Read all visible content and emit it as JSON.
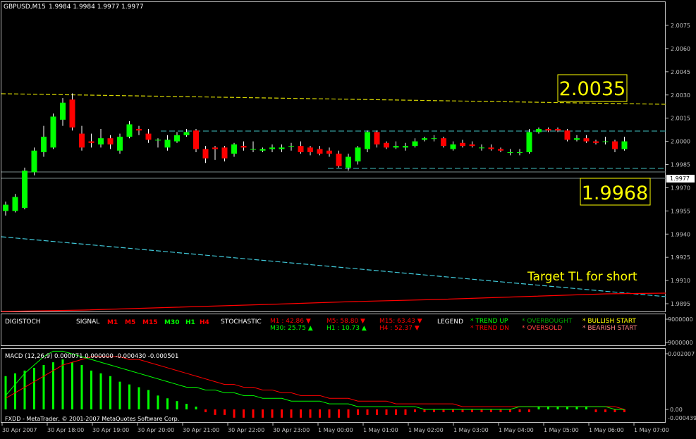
{
  "symbol_header": "GBPUSD,M15",
  "ohlc_header": "1.9984 1.9984 1.9977 1.9977",
  "colors": {
    "bull": "#00ff00",
    "bear": "#ff0000",
    "wick": "#ffffff",
    "grid": "#2a3a3a",
    "axis": "#c0c0c0",
    "upper_tl": "#d6d600",
    "box_text": "#ffff00",
    "range_line": "#40c0c0",
    "target_tl": "#40c8d8",
    "red_ma": "#ff0000",
    "macd_signal": "#ff0000",
    "macd_main": "#00ff00",
    "macd_hist": "#ff0000"
  },
  "main_chart": {
    "price_axis": [
      "2.0075",
      "2.0060",
      "2.0045",
      "2.0030",
      "2.0015",
      "2.0000",
      "1.9985",
      "1.9970",
      "1.9955",
      "1.9940",
      "1.9925",
      "1.9910",
      "1.9895"
    ],
    "current_price_tag": "1.9977",
    "label_upper": "2.0035",
    "label_lower": "1.9968",
    "annotation": "Target TL for short",
    "candles": [
      {
        "o": 1.9955,
        "h": 1.9961,
        "l": 1.9952,
        "c": 1.9959
      },
      {
        "o": 1.9955,
        "h": 1.9966,
        "l": 1.9954,
        "c": 1.9964
      },
      {
        "o": 1.9957,
        "h": 1.9983,
        "l": 1.9956,
        "c": 1.9981
      },
      {
        "o": 1.998,
        "h": 1.9996,
        "l": 1.9978,
        "c": 1.9994
      },
      {
        "o": 1.9993,
        "h": 2.001,
        "l": 1.999,
        "c": 2.0003
      },
      {
        "o": 1.9996,
        "h": 2.0018,
        "l": 1.9995,
        "c": 2.0016
      },
      {
        "o": 2.0014,
        "h": 2.0028,
        "l": 2.001,
        "c": 2.0025
      },
      {
        "o": 2.0027,
        "h": 2.0031,
        "l": 2.0007,
        "c": 2.0009
      },
      {
        "o": 2.0005,
        "h": 2.001,
        "l": 1.9994,
        "c": 1.9996
      },
      {
        "o": 2.0,
        "h": 2.0005,
        "l": 1.9996,
        "c": 1.9999
      },
      {
        "o": 1.9998,
        "h": 2.0008,
        "l": 1.9996,
        "c": 2.0002
      },
      {
        "o": 2.0002,
        "h": 2.0004,
        "l": 1.9995,
        "c": 1.9998
      },
      {
        "o": 1.9994,
        "h": 2.0005,
        "l": 1.9992,
        "c": 2.0003
      },
      {
        "o": 2.0003,
        "h": 2.0013,
        "l": 2.0002,
        "c": 2.0011
      },
      {
        "o": 2.0008,
        "h": 2.001,
        "l": 2.0004,
        "c": 2.0007
      },
      {
        "o": 2.0005,
        "h": 2.0008,
        "l": 1.9999,
        "c": 2.0001
      },
      {
        "o": 2.0001,
        "h": 2.0002,
        "l": 1.9996,
        "c": 2.0001
      },
      {
        "o": 1.9996,
        "h": 2.0004,
        "l": 1.9994,
        "c": 2.0001
      },
      {
        "o": 2.0,
        "h": 2.0006,
        "l": 1.9999,
        "c": 2.0004
      },
      {
        "o": 2.0004,
        "h": 2.0008,
        "l": 2.0003,
        "c": 2.0006
      },
      {
        "o": 2.0007,
        "h": 2.0008,
        "l": 1.9993,
        "c": 1.9995
      },
      {
        "o": 1.9995,
        "h": 1.9997,
        "l": 1.9986,
        "c": 1.9989
      },
      {
        "o": 1.9996,
        "h": 1.9997,
        "l": 1.9988,
        "c": 1.9995
      },
      {
        "o": 1.9996,
        "h": 1.9997,
        "l": 1.9987,
        "c": 1.9989
      },
      {
        "o": 1.9992,
        "h": 1.9999,
        "l": 1.999,
        "c": 1.9998
      },
      {
        "o": 1.9997,
        "h": 2.0,
        "l": 1.9994,
        "c": 1.9996
      },
      {
        "o": 1.9995,
        "h": 2.0,
        "l": 1.9993,
        "c": 1.9995
      },
      {
        "o": 1.9994,
        "h": 1.9996,
        "l": 1.9993,
        "c": 1.9995
      },
      {
        "o": 1.9995,
        "h": 1.9998,
        "l": 1.9993,
        "c": 1.9996
      },
      {
        "o": 1.9995,
        "h": 1.9998,
        "l": 1.9993,
        "c": 1.9996
      },
      {
        "o": 1.9997,
        "h": 1.9999,
        "l": 1.9994,
        "c": 1.9997
      },
      {
        "o": 1.9997,
        "h": 2.0,
        "l": 1.9992,
        "c": 1.9993
      },
      {
        "o": 1.9996,
        "h": 1.9997,
        "l": 1.9991,
        "c": 1.9993
      },
      {
        "o": 1.9995,
        "h": 1.9997,
        "l": 1.9991,
        "c": 1.9992
      },
      {
        "o": 1.9994,
        "h": 1.9996,
        "l": 1.999,
        "c": 1.9992
      },
      {
        "o": 1.9992,
        "h": 1.9994,
        "l": 1.9983,
        "c": 1.9984
      },
      {
        "o": 1.9983,
        "h": 1.9992,
        "l": 1.9981,
        "c": 1.999
      },
      {
        "o": 1.9987,
        "h": 1.9997,
        "l": 1.9985,
        "c": 1.9996
      },
      {
        "o": 1.9995,
        "h": 2.0007,
        "l": 1.9993,
        "c": 2.0006
      },
      {
        "o": 2.0006,
        "h": 2.0007,
        "l": 1.9996,
        "c": 1.9998
      },
      {
        "o": 1.9999,
        "h": 2.0,
        "l": 1.9995,
        "c": 1.9996
      },
      {
        "o": 1.9996,
        "h": 2.0,
        "l": 1.9995,
        "c": 1.9997
      },
      {
        "o": 1.9996,
        "h": 1.9999,
        "l": 1.9994,
        "c": 1.9997
      },
      {
        "o": 1.9997,
        "h": 2.0002,
        "l": 1.9996,
        "c": 2.0
      },
      {
        "o": 2.0001,
        "h": 2.0003,
        "l": 2.0,
        "c": 2.0002
      },
      {
        "o": 2.0002,
        "h": 2.0004,
        "l": 2.0,
        "c": 2.0002
      },
      {
        "o": 2.0002,
        "h": 2.0003,
        "l": 1.9996,
        "c": 1.9997
      },
      {
        "o": 1.9995,
        "h": 2.0,
        "l": 1.9994,
        "c": 1.9998
      },
      {
        "o": 1.9999,
        "h": 2.0001,
        "l": 1.9996,
        "c": 1.9997
      },
      {
        "o": 1.9998,
        "h": 2.0,
        "l": 1.9996,
        "c": 1.9997
      },
      {
        "o": 1.9996,
        "h": 1.9998,
        "l": 1.9994,
        "c": 1.9996
      },
      {
        "o": 1.9996,
        "h": 1.9998,
        "l": 1.9994,
        "c": 1.9995
      },
      {
        "o": 1.9995,
        "h": 1.9996,
        "l": 1.9993,
        "c": 1.9994
      },
      {
        "o": 1.9993,
        "h": 1.9995,
        "l": 1.9991,
        "c": 1.9993
      },
      {
        "o": 1.9993,
        "h": 1.9995,
        "l": 1.9991,
        "c": 1.9993
      },
      {
        "o": 1.9993,
        "h": 2.0008,
        "l": 1.9992,
        "c": 2.0006
      },
      {
        "o": 2.0006,
        "h": 2.0009,
        "l": 2.0005,
        "c": 2.0008
      },
      {
        "o": 2.0008,
        "h": 2.0009,
        "l": 2.0006,
        "c": 2.0007
      },
      {
        "o": 2.0008,
        "h": 2.0009,
        "l": 2.0006,
        "c": 2.0007
      },
      {
        "o": 2.0007,
        "h": 2.0008,
        "l": 2.0,
        "c": 2.0001
      },
      {
        "o": 2.0001,
        "h": 2.0004,
        "l": 2.0,
        "c": 2.0002
      },
      {
        "o": 2.0002,
        "h": 2.0004,
        "l": 1.9999,
        "c": 2.0
      },
      {
        "o": 2.0,
        "h": 2.0001,
        "l": 1.9998,
        "c": 1.9999
      },
      {
        "o": 2.0,
        "h": 2.0003,
        "l": 1.9998,
        "c": 2.0
      },
      {
        "o": 2.0,
        "h": 2.0001,
        "l": 1.9993,
        "c": 1.9995
      },
      {
        "o": 1.9995,
        "h": 2.0003,
        "l": 1.9994,
        "c": 2.0
      }
    ]
  },
  "digistoch": {
    "title": "DIGISTOCH",
    "signal_label": "SIGNAL",
    "tf_red": [
      "M1",
      "M5",
      "M15"
    ],
    "tf_green": [
      "M30",
      "H1"
    ],
    "tf_red2": [
      "H4"
    ],
    "stochastic_label": "STOCHASTIC",
    "stoch": {
      "m1": "M1   : 42.86 ▼",
      "m5": "M5: 58.80 ▼",
      "m15": "M15: 63.43 ▼",
      "m30": "M30: 25.75 ▲",
      "h1": "H1  : 10.73 ▲",
      "h4": "H4   : 52.37 ▼"
    },
    "legend_label": "LEGEND",
    "legend": {
      "trend_up": "* TREND UP",
      "trend_dn": "* TREND DN",
      "overbought": "* OVERBOUGHT",
      "oversold": "* OVERSOLD",
      "bullish": "* BULLISH START",
      "bearish": "* BEARISH START"
    },
    "axis_top": "9000000",
    "axis_bottom": "9000000"
  },
  "macd": {
    "header": "MACD  (12,26,9) 0.000071 0.000000 -0.000430 -0.000501",
    "axis_top": "0.002007",
    "axis_zero": "0.00",
    "axis_bottom": "-0.000439",
    "footer": "FXDD - MetaTrader, © 2001-2007 MetaQuotes Software Corp.",
    "hist": [
      0.0012,
      0.0013,
      0.0014,
      0.0015,
      0.0016,
      0.0017,
      0.0018,
      0.0017,
      0.0016,
      0.0014,
      0.0013,
      0.0012,
      0.001,
      0.0009,
      0.0008,
      0.0007,
      0.0005,
      0.0004,
      0.0003,
      0.0002,
      0.0001,
      -0.0001,
      -0.0002,
      -0.0002,
      -0.0003,
      -0.0003,
      -0.0003,
      -0.0003,
      -0.0003,
      -0.0003,
      -0.0003,
      -0.0003,
      -0.0003,
      -0.0003,
      -0.0003,
      -0.0003,
      -0.0003,
      -0.0002,
      -0.0002,
      -0.0002,
      -0.0002,
      -0.0002,
      -0.0002,
      -0.0001,
      -0.0001,
      -0.0001,
      -0.0001,
      -0.0001,
      -0.0001,
      -0.0001,
      -0.0001,
      -0.0001,
      -0.0001,
      -0.0001,
      -0.0001,
      -0.0001,
      0.0001,
      0.0001,
      0.0001,
      0.0001,
      0.0001,
      0.0001,
      -0.0001,
      -0.0001,
      -0.0001,
      -0.0001
    ],
    "signal": [
      0.0004,
      0.0006,
      0.0008,
      0.001,
      0.0012,
      0.0014,
      0.0016,
      0.0017,
      0.0018,
      0.0019,
      0.0019,
      0.0019,
      0.0019,
      0.0018,
      0.0018,
      0.0017,
      0.0016,
      0.0015,
      0.0014,
      0.0013,
      0.0012,
      0.0011,
      0.001,
      0.0009,
      0.0009,
      0.0008,
      0.0008,
      0.0007,
      0.0007,
      0.0006,
      0.0006,
      0.0005,
      0.0005,
      0.0005,
      0.0004,
      0.0004,
      0.0004,
      0.0003,
      0.0003,
      0.0003,
      0.0003,
      0.0002,
      0.0002,
      0.0002,
      0.0002,
      0.0002,
      0.0002,
      0.0002,
      0.0001,
      0.0001,
      0.0001,
      0.0001,
      0.0001,
      0.0001,
      0.0001,
      0.0001,
      0.0001,
      0.0001,
      0.0001,
      0.0001,
      0.0001,
      0.0001,
      0.0001,
      0.0001,
      0.0001,
      0.0
    ],
    "main": [
      0.0005,
      0.0009,
      0.0013,
      0.0016,
      0.0019,
      0.0021,
      0.0021,
      0.002,
      0.0019,
      0.0018,
      0.0017,
      0.0016,
      0.0015,
      0.0014,
      0.0013,
      0.0012,
      0.0011,
      0.001,
      0.0009,
      0.0008,
      0.0008,
      0.0007,
      0.0007,
      0.0006,
      0.0006,
      0.0005,
      0.0005,
      0.0004,
      0.0004,
      0.0004,
      0.0003,
      0.0003,
      0.0003,
      0.0003,
      0.0002,
      0.0002,
      0.0002,
      0.0001,
      0.0001,
      0.0001,
      0.0001,
      0.0001,
      0.0001,
      0.0001,
      0.0,
      0.0,
      0.0,
      0.0,
      0.0,
      0.0,
      0.0,
      0.0,
      0.0,
      0.0,
      0.0001,
      0.0001,
      0.0001,
      0.0001,
      0.0001,
      0.0001,
      0.0001,
      0.0001,
      0.0001,
      0.0001,
      0.0,
      0.0
    ]
  },
  "time_axis": [
    "30 Apr 2007",
    "30 Apr 18:00",
    "30 Apr 19:00",
    "30 Apr 20:00",
    "30 Apr 21:00",
    "30 Apr 22:00",
    "30 Apr 23:00",
    "1 May 00:00",
    "1 May 01:00",
    "1 May 02:00",
    "1 May 03:00",
    "1 May 04:00",
    "1 May 05:00",
    "1 May 06:00",
    "1 May 07:00"
  ]
}
